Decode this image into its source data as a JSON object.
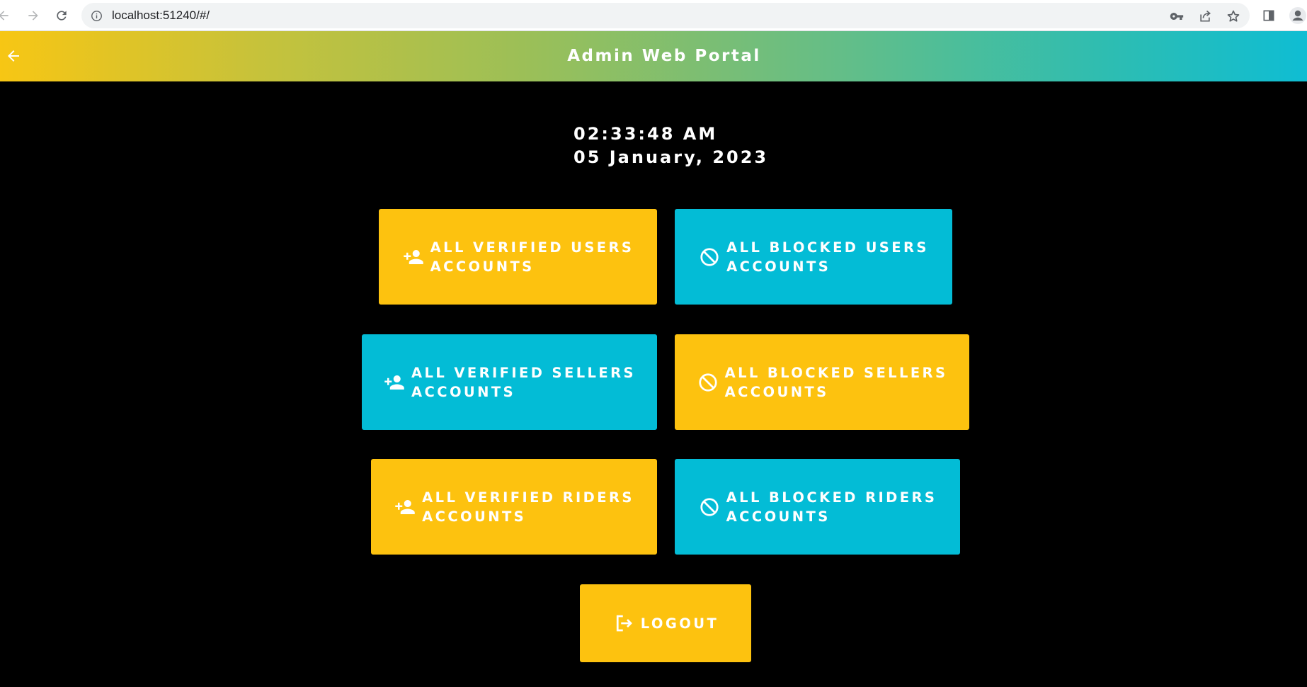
{
  "browser": {
    "url": "localhost:51240/#/"
  },
  "header": {
    "title": "Admin Web Portal"
  },
  "clock": {
    "time": "02:33:48 AM",
    "date": "05 January, 2023"
  },
  "buttons": {
    "verified_users": {
      "line1": "ALL VERIFIED USERS",
      "line2": "ACCOUNTS"
    },
    "blocked_users": {
      "line1": "ALL BLOCKED USERS",
      "line2": "ACCOUNTS"
    },
    "verified_sellers": {
      "line1": "ALL VERIFIED SELLERS",
      "line2": "ACCOUNTS"
    },
    "blocked_sellers": {
      "line1": "ALL BLOCKED SELLERS",
      "line2": "ACCOUNTS"
    },
    "verified_riders": {
      "line1": "ALL VERIFIED RIDERS",
      "line2": "ACCOUNTS"
    },
    "blocked_riders": {
      "line1": "ALL BLOCKED RIDERS",
      "line2": "ACCOUNTS"
    },
    "logout": {
      "label": "LOGOUT"
    }
  },
  "colors": {
    "yellow_button": "#fdc20f",
    "cyan_button": "#03bcd6",
    "background": "#000000",
    "header_gradient_start": "#f7c614",
    "header_gradient_end": "#0fbdd3"
  },
  "icons": {
    "browser": [
      "back-arrow-icon",
      "forward-arrow-icon",
      "reload-icon",
      "info-icon",
      "key-icon",
      "share-icon",
      "star-icon",
      "side-panel-icon",
      "profile-icon"
    ],
    "verified": "person-add-icon",
    "blocked": "block-icon",
    "logout": "logout-icon",
    "header_back": "arrow-back-icon"
  }
}
